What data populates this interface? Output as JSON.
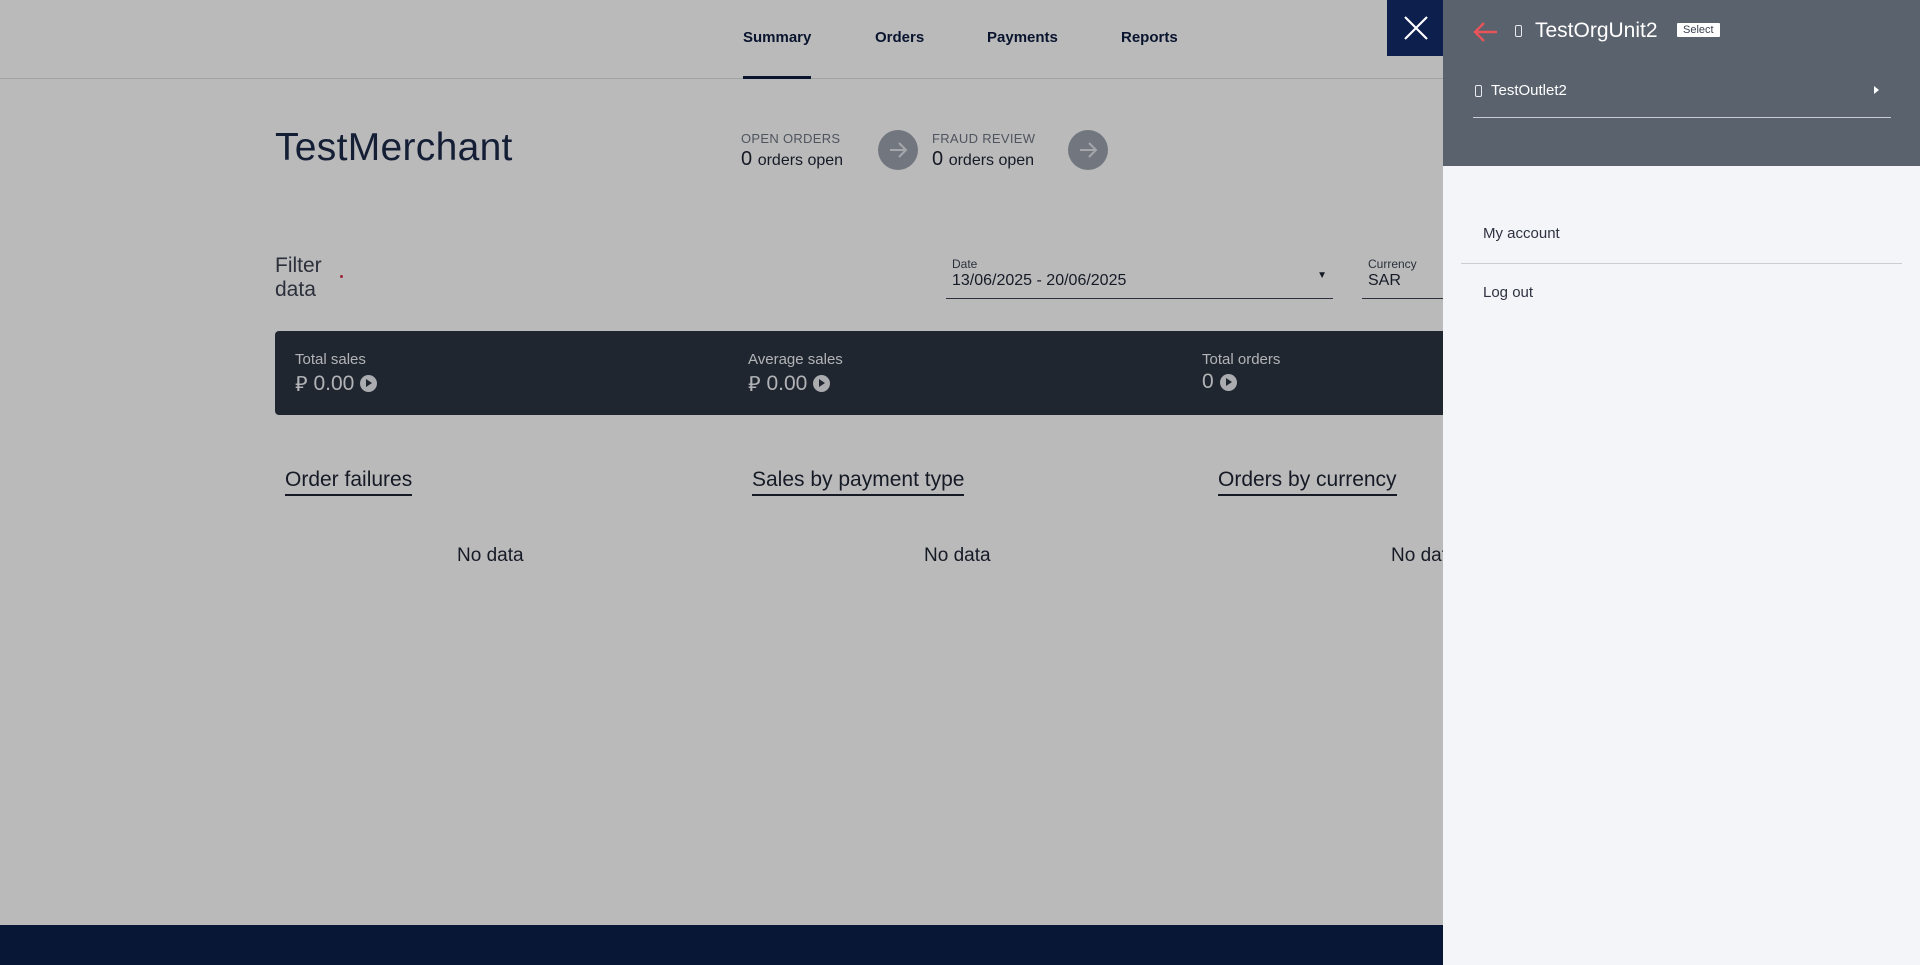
{
  "nav": {
    "tabs": [
      {
        "label": "Summary",
        "active": true
      },
      {
        "label": "Orders"
      },
      {
        "label": "Payments"
      },
      {
        "label": "Reports"
      }
    ]
  },
  "merchant": {
    "name": "TestMerchant"
  },
  "summary": {
    "open_orders": {
      "label": "OPEN ORDERS",
      "count": "0",
      "suffix": "orders open"
    },
    "fraud_review": {
      "label": "FRAUD REVIEW",
      "count": "0",
      "suffix": "orders open"
    }
  },
  "filter": {
    "label": "Filter data",
    "date": {
      "label": "Date",
      "value": "13/06/2025 - 20/06/2025"
    },
    "currency": {
      "label": "Currency",
      "value": "SAR"
    }
  },
  "metrics": [
    {
      "label": "Total sales",
      "currency_symbol": "⃁",
      "value": "0.00"
    },
    {
      "label": "Average sales",
      "currency_symbol": "⃁",
      "value": "0.00"
    },
    {
      "label": "Total orders",
      "value": "0"
    }
  ],
  "cards": [
    {
      "title": "Order failures",
      "empty": "No data"
    },
    {
      "title": "Sales by payment type",
      "empty": "No data"
    },
    {
      "title": "Orders by currency",
      "empty": "No data"
    }
  ],
  "panel": {
    "org_unit": "TestOrgUnit2",
    "select_label": "Select",
    "outlet": "TestOutlet2",
    "menu": [
      {
        "label": "My account"
      },
      {
        "label": "Log out"
      }
    ]
  },
  "colors": {
    "navy": "#0d1f4c",
    "panel_header": "#5a626d",
    "back_arrow": "#e8545a",
    "metrics_bar": "#2c3441"
  }
}
